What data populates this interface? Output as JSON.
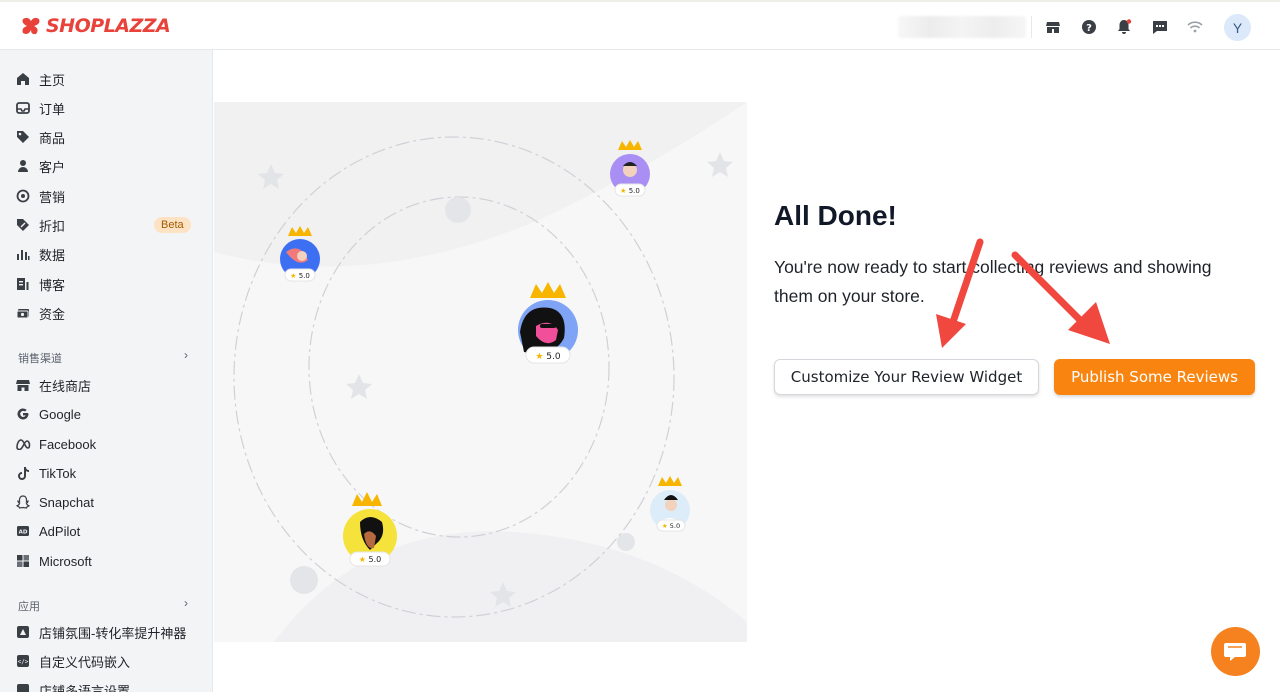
{
  "brand": {
    "name": "SHOPLAZZA",
    "color": "#e8423b"
  },
  "topbar": {
    "icons": [
      "store-icon",
      "help-icon",
      "notification-icon",
      "message-icon",
      "wifi-icon"
    ],
    "avatar_initial": "Y"
  },
  "sidebar": {
    "main_items": [
      {
        "label": "主页",
        "icon": "home-icon"
      },
      {
        "label": "订单",
        "icon": "inbox-icon"
      },
      {
        "label": "商品",
        "icon": "tag-icon"
      },
      {
        "label": "客户",
        "icon": "person-icon"
      },
      {
        "label": "营销",
        "icon": "target-icon"
      },
      {
        "label": "折扣",
        "icon": "discount-icon",
        "badge": "Beta"
      },
      {
        "label": "数据",
        "icon": "bar-chart-icon"
      },
      {
        "label": "博客",
        "icon": "blog-icon"
      },
      {
        "label": "资金",
        "icon": "money-icon"
      }
    ],
    "sales_channels_title": "销售渠道",
    "sales_channels": [
      {
        "label": "在线商店",
        "icon": "store-icon"
      },
      {
        "label": "Google",
        "icon": "google-icon"
      },
      {
        "label": "Facebook",
        "icon": "meta-icon"
      },
      {
        "label": "TikTok",
        "icon": "tiktok-icon"
      },
      {
        "label": "Snapchat",
        "icon": "snapchat-icon"
      },
      {
        "label": "AdPilot",
        "icon": "ad-icon"
      },
      {
        "label": "Microsoft",
        "icon": "microsoft-icon"
      }
    ],
    "apps_title": "应用",
    "apps": [
      {
        "label": "店铺氛围-转化率提升神器",
        "icon": "app-icon"
      },
      {
        "label": "自定义代码嵌入",
        "icon": "code-icon"
      },
      {
        "label": "店铺多语言设置",
        "icon": "language-icon"
      }
    ]
  },
  "main": {
    "title": "All Done!",
    "description": "You're now ready to start collecting reviews and showing them on your store.",
    "customize_button": "Customize Your Review Widget",
    "publish_button": "Publish Some Reviews",
    "rating_badges": [
      "5.0",
      "5.0",
      "5.0",
      "5.0",
      "5.0"
    ]
  },
  "colors": {
    "accent": "#f98410",
    "arrow": "#f0473e",
    "sidebar_bg": "#f3f4f5"
  }
}
